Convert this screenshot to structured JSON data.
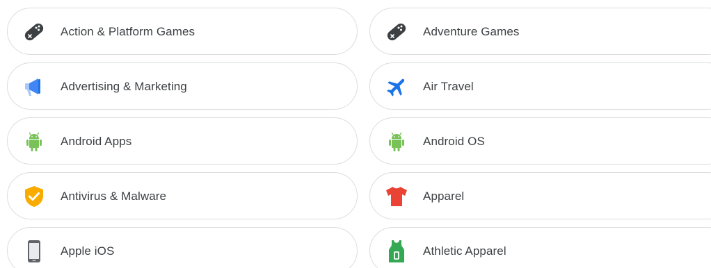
{
  "categories": [
    {
      "label": "Action & Platform Games",
      "icon": "gamepad-icon",
      "color": "#3c4043"
    },
    {
      "label": "Adventure Games",
      "icon": "gamepad-icon",
      "color": "#3c4043"
    },
    {
      "label": "Advertising & Marketing",
      "icon": "megaphone-icon",
      "color": "#4285f4"
    },
    {
      "label": "Air Travel",
      "icon": "airplane-icon",
      "color": "#4285f4"
    },
    {
      "label": "Android Apps",
      "icon": "android-icon",
      "color": "#78c257"
    },
    {
      "label": "Android OS",
      "icon": "android-icon",
      "color": "#78c257"
    },
    {
      "label": "Antivirus & Malware",
      "icon": "shield-check-icon",
      "color": "#f9ab00"
    },
    {
      "label": "Apparel",
      "icon": "tshirt-icon",
      "color": "#ea4335"
    },
    {
      "label": "Apple iOS",
      "icon": "phone-icon",
      "color": "#5f6368"
    },
    {
      "label": "Athletic Apparel",
      "icon": "jersey-icon",
      "color": "#34a853"
    }
  ]
}
